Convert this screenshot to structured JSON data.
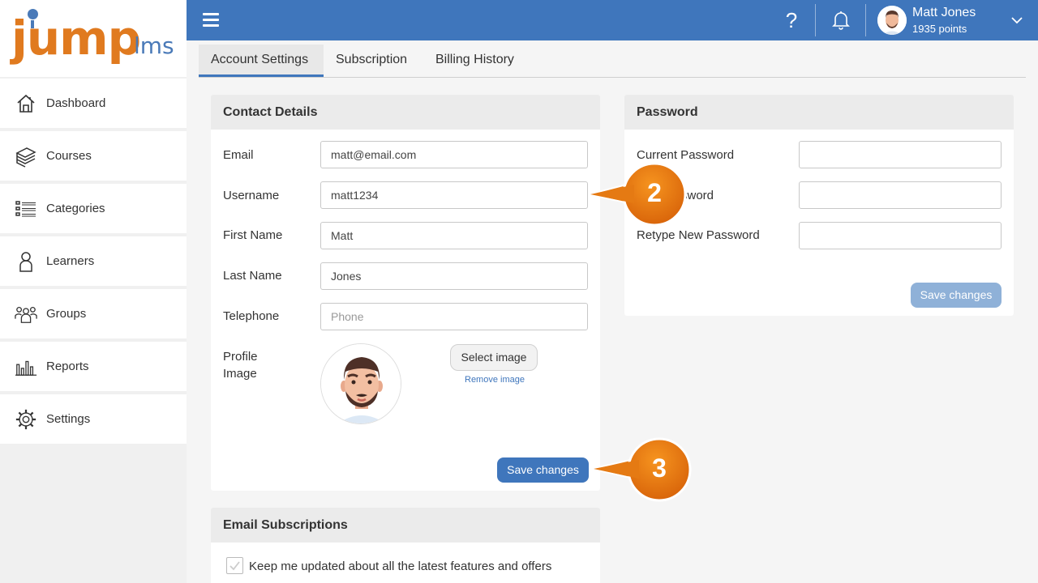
{
  "brand": {
    "logo_main": "jump",
    "logo_sub": "lms",
    "accent": "#3f76bc",
    "orange": "#e07a1f"
  },
  "sidebar": {
    "items": [
      {
        "label": "Dashboard",
        "icon": "home-icon"
      },
      {
        "label": "Courses",
        "icon": "stack-icon"
      },
      {
        "label": "Categories",
        "icon": "list-icon"
      },
      {
        "label": "Learners",
        "icon": "person-icon"
      },
      {
        "label": "Groups",
        "icon": "group-icon"
      },
      {
        "label": "Reports",
        "icon": "bar-chart-icon"
      },
      {
        "label": "Settings",
        "icon": "gear-icon"
      }
    ]
  },
  "header": {
    "menu_icon": "hamburger-icon",
    "help_icon": "question-icon",
    "help_glyph": "?",
    "bell_icon": "bell-icon",
    "user_name": "Matt Jones",
    "user_points": "1935 points",
    "dropdown_icon": "chevron-down-icon"
  },
  "tabs": [
    {
      "label": "Account Settings",
      "active": true
    },
    {
      "label": "Subscription",
      "active": false
    },
    {
      "label": "Billing History",
      "active": false
    }
  ],
  "contact": {
    "title": "Contact Details",
    "fields": [
      {
        "label": "Email",
        "value": "matt@email.com",
        "placeholder": ""
      },
      {
        "label": "Username",
        "value": "matt1234",
        "placeholder": ""
      },
      {
        "label": "First Name",
        "value": "Matt",
        "placeholder": ""
      },
      {
        "label": "Last Name",
        "value": "Jones",
        "placeholder": ""
      },
      {
        "label": "Telephone",
        "value": "",
        "placeholder": "Phone"
      }
    ],
    "profile_label_line1": "Profile",
    "profile_label_line2": "Image",
    "select_image": "Select image",
    "remove_image": "Remove image",
    "save": "Save changes"
  },
  "password": {
    "title": "Password",
    "fields": [
      {
        "label": "Current Password"
      },
      {
        "label": "sword"
      },
      {
        "label": "Retype New Password"
      }
    ],
    "save": "Save changes"
  },
  "email_subs": {
    "title": "Email Subscriptions",
    "option": "Keep me updated about all the latest features and offers"
  },
  "callouts": [
    "2",
    "3"
  ]
}
